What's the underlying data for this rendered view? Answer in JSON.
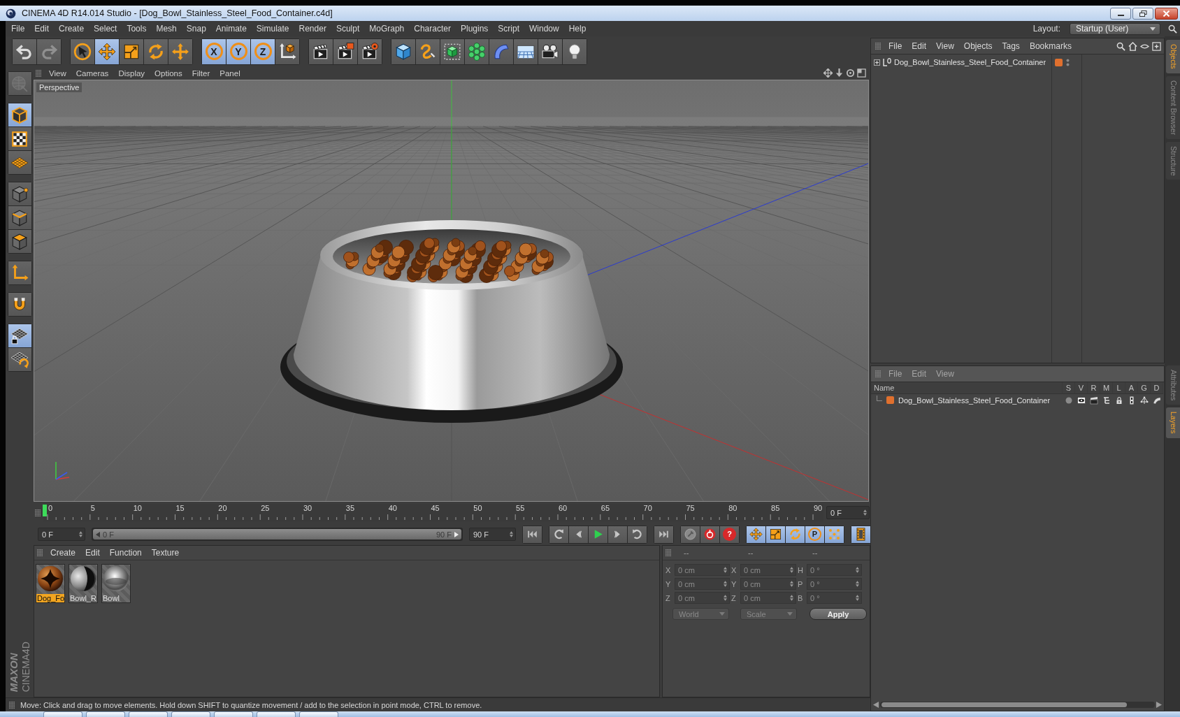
{
  "window": {
    "title": "CINEMA 4D R14.014 Studio - [Dog_Bowl_Stainless_Steel_Food_Container.c4d]"
  },
  "menu": [
    "File",
    "Edit",
    "Create",
    "Select",
    "Tools",
    "Mesh",
    "Snap",
    "Animate",
    "Simulate",
    "Render",
    "Sculpt",
    "MoGraph",
    "Character",
    "Plugins",
    "Script",
    "Window",
    "Help"
  ],
  "layout": {
    "label": "Layout:",
    "value": "Startup (User)"
  },
  "toolbar": [
    [
      {
        "kind": "undo",
        "selected": false,
        "disabled": false
      },
      {
        "kind": "redo",
        "selected": false,
        "disabled": true
      }
    ],
    [
      {
        "kind": "select",
        "selected": false,
        "disabled": false
      },
      {
        "kind": "move",
        "selected": true,
        "disabled": false
      },
      {
        "kind": "scale",
        "selected": false,
        "disabled": false
      },
      {
        "kind": "rotate",
        "selected": false,
        "disabled": false
      },
      {
        "kind": "create",
        "selected": false,
        "disabled": false
      }
    ],
    [
      {
        "kind": "xaxis",
        "label": "X",
        "selected": true,
        "disabled": false
      },
      {
        "kind": "yaxis",
        "label": "Y",
        "selected": true,
        "disabled": false
      },
      {
        "kind": "zaxis",
        "label": "Z",
        "selected": true,
        "disabled": false
      },
      {
        "kind": "coordinates",
        "selected": false,
        "disabled": false
      }
    ],
    [
      {
        "kind": "renderview",
        "selected": false,
        "disabled": false
      },
      {
        "kind": "renderpicture",
        "selected": false,
        "disabled": false
      },
      {
        "kind": "rendersettings",
        "selected": false,
        "disabled": false
      }
    ],
    [
      {
        "kind": "cube",
        "selected": false,
        "disabled": false
      },
      {
        "kind": "spline",
        "selected": false,
        "disabled": false
      },
      {
        "kind": "subdivision",
        "selected": false,
        "disabled": false
      },
      {
        "kind": "cloner",
        "selected": false,
        "disabled": false
      },
      {
        "kind": "deformer",
        "selected": false,
        "disabled": false
      },
      {
        "kind": "floor",
        "selected": false,
        "disabled": false
      },
      {
        "kind": "camera",
        "selected": false,
        "disabled": false
      },
      {
        "kind": "light",
        "selected": false,
        "disabled": false
      }
    ]
  ],
  "tools": [
    [
      {
        "kind": "renderedit",
        "selected": false,
        "disabled": true
      }
    ],
    [
      {
        "kind": "model",
        "selected": true,
        "disabled": false
      },
      {
        "kind": "texture",
        "selected": false,
        "disabled": false
      },
      {
        "kind": "workplane",
        "selected": false,
        "disabled": false
      }
    ],
    [
      {
        "kind": "points",
        "selected": false,
        "disabled": false
      },
      {
        "kind": "edges",
        "selected": false,
        "disabled": false
      },
      {
        "kind": "polygons",
        "selected": false,
        "disabled": false
      }
    ],
    [
      {
        "kind": "axis",
        "selected": false,
        "disabled": false
      }
    ],
    [
      {
        "kind": "tweak",
        "selected": false,
        "disabled": false
      }
    ],
    [
      {
        "kind": "gridlock",
        "selected": true,
        "disabled": false
      },
      {
        "kind": "gridrotate",
        "selected": false,
        "disabled": false
      }
    ]
  ],
  "logo": [
    "MAXON",
    "CINEMA4D"
  ],
  "viewport": {
    "menu": [
      "View",
      "Cameras",
      "Display",
      "Options",
      "Filter",
      "Panel"
    ],
    "camera": "Perspective"
  },
  "timeline": {
    "labels": [
      "0",
      "5",
      "10",
      "15",
      "20",
      "25",
      "30",
      "35",
      "40",
      "45",
      "50",
      "55",
      "60",
      "65",
      "70",
      "75",
      "80",
      "85",
      "90"
    ],
    "level": 0,
    "frame": "0 F"
  },
  "playback": {
    "start": "0 F",
    "range": {
      "start_label": "0 F",
      "end_label": "90 F",
      "level": 1
    },
    "end": "90 F",
    "buttons": [
      [
        {
          "kind": "first",
          "selected": false
        }
      ],
      [
        {
          "kind": "prevkey",
          "selected": false
        },
        {
          "kind": "prev",
          "selected": false
        },
        {
          "kind": "play",
          "selected": false
        },
        {
          "kind": "next",
          "selected": false
        },
        {
          "kind": "nextkey",
          "selected": false
        }
      ],
      [
        {
          "kind": "last",
          "selected": false
        }
      ],
      [
        {
          "kind": "autokey",
          "selected": false
        },
        {
          "kind": "record",
          "selected": false
        },
        {
          "kind": "help",
          "label": "?",
          "selected": false
        }
      ],
      [
        {
          "kind": "keymove",
          "selected": true
        },
        {
          "kind": "keyscale",
          "selected": true
        },
        {
          "kind": "keyrotate",
          "selected": true
        },
        {
          "kind": "param",
          "label": "P",
          "selected": true
        },
        {
          "kind": "pla",
          "selected": true
        }
      ],
      [
        {
          "kind": "timeline",
          "selected": true
        }
      ]
    ]
  },
  "materials": {
    "menu": [
      "Create",
      "Edit",
      "Function",
      "Texture"
    ],
    "items": [
      {
        "kind": "food",
        "name": "Dog_Fo",
        "selected": true
      },
      {
        "kind": "rubber",
        "name": "Bowl_R",
        "selected": false
      },
      {
        "kind": "steel",
        "name": "Bowl",
        "selected": false
      }
    ]
  },
  "coordinates": {
    "headers": [
      "--",
      "--",
      "--"
    ],
    "rows": [
      [
        {
          "axis": "X",
          "value": "0 cm"
        },
        {
          "axis": "X",
          "value": "0 cm"
        },
        {
          "axis": "H",
          "value": "0 °"
        }
      ],
      [
        {
          "axis": "Y",
          "value": "0 cm"
        },
        {
          "axis": "Y",
          "value": "0 cm"
        },
        {
          "axis": "P",
          "value": "0 °"
        }
      ],
      [
        {
          "axis": "Z",
          "value": "0 cm"
        },
        {
          "axis": "Z",
          "value": "0 cm"
        },
        {
          "axis": "B",
          "value": "0 °"
        }
      ]
    ],
    "dropdowns": [
      {
        "value": "World",
        "disabled": true
      },
      {
        "value": "Scale",
        "disabled": true
      }
    ],
    "apply": "Apply"
  },
  "objects": {
    "menu": [
      "File",
      "Edit",
      "View",
      "Objects",
      "Tags",
      "Bookmarks"
    ],
    "items": [
      {
        "name": "Dog_Bowl_Stainless_Steel_Food_Container",
        "color": "#e0702e",
        "expanded": false
      }
    ]
  },
  "layers": {
    "menu": [
      "File",
      "Edit",
      "View"
    ],
    "columns": [
      "Name",
      "S",
      "V",
      "R",
      "M",
      "L",
      "A",
      "G",
      "D"
    ],
    "rows": [
      {
        "name": "Dog_Bowl_Stainless_Steel_Food_Container",
        "color": "#e0702e"
      }
    ]
  },
  "side_tabs": {
    "upper": [
      {
        "label": "Objects",
        "selected": true
      },
      {
        "label": "Content Browser",
        "selected": false
      },
      {
        "label": "Structure",
        "selected": false
      }
    ],
    "lower": [
      {
        "label": "Attributes",
        "selected": false
      },
      {
        "label": "Layers",
        "selected": true
      }
    ]
  },
  "status_bar": "Move: Click and drag to move elements. Hold down SHIFT to quantize movement / add to the selection in point mode, CTRL to remove."
}
